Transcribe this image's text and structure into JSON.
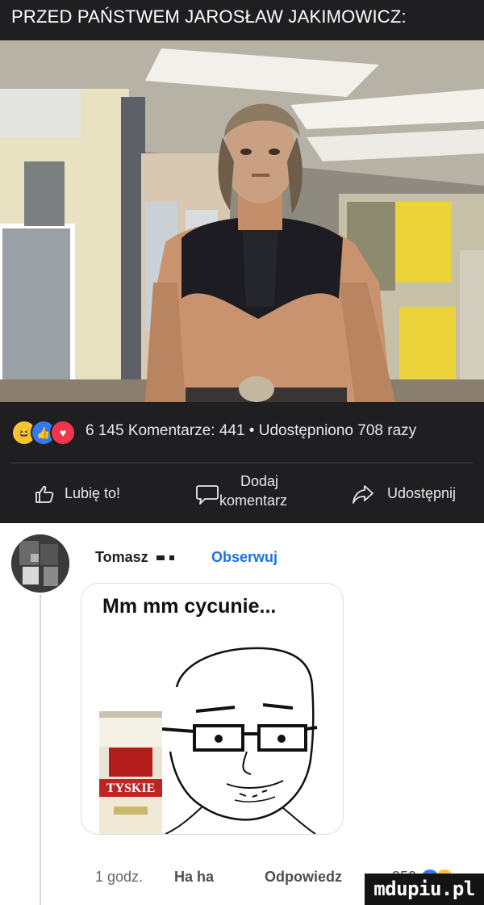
{
  "post": {
    "caption": "PRZED PAŃSTWEM JAROSŁAW JAKIMOWICZ:",
    "stats_text": "6 145  Komentarze: 441 • Udostępniono 708 razy",
    "reactions": [
      "haha",
      "like",
      "love"
    ],
    "actions": {
      "like_label": "Lubię to!",
      "comment_label_line1": "Dodaj",
      "comment_label_line2": "komentarz",
      "share_label": "Udostępnij"
    }
  },
  "comment": {
    "author": "Tomasz",
    "follow_label": "Obserwuj",
    "text": "Mm mm cycunie...",
    "meme_can_label": "TYSKIE",
    "time": "1 godz.",
    "reaction_label": "Ha ha",
    "reply_label": "Odpowiedz",
    "reaction_count": "250"
  },
  "watermark": "mdupiu.pl",
  "colors": {
    "post_bg": "#1f1f21",
    "follow_blue": "#1a73e8",
    "like_blue": "#2f7bf3",
    "love_red": "#f0354e",
    "haha_yellow": "#f7c531"
  }
}
